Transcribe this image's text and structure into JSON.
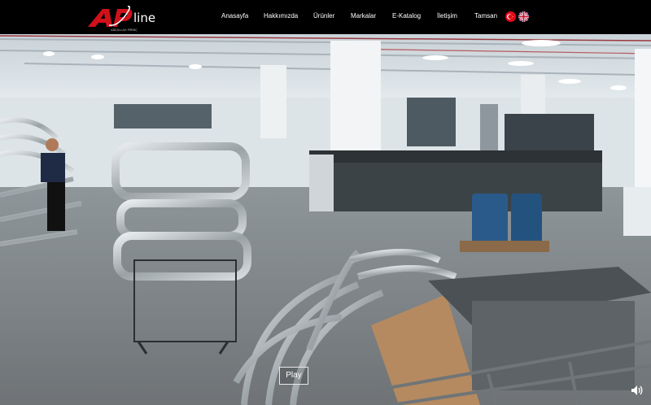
{
  "brand": {
    "logo_text": "AP",
    "logo_suffix": "line",
    "logo_tagline": "ABDULLAH PİRİNÇ"
  },
  "nav": {
    "items": [
      {
        "label": "Anasayfa"
      },
      {
        "label": "Hakkımızda"
      },
      {
        "label": "Ürünler"
      },
      {
        "label": "Markalar"
      },
      {
        "label": "E-Katalog"
      },
      {
        "label": "İletişim"
      },
      {
        "label": "Tamsan"
      }
    ],
    "languages": [
      {
        "name": "turkish-flag-icon"
      },
      {
        "name": "english-flag-icon"
      }
    ]
  },
  "video": {
    "play_label": "Play",
    "volume_icon": "volume-icon"
  },
  "colors": {
    "header_bg": "#000000",
    "brand_red": "#d0111b",
    "nav_text": "#ffffff"
  }
}
